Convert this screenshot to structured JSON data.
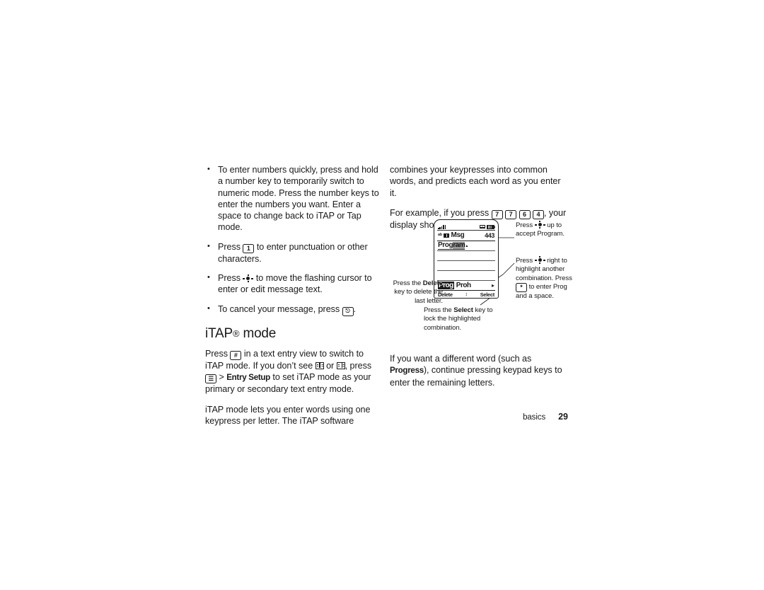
{
  "document": {
    "footer": {
      "section_label": "basics",
      "page_number": "29"
    }
  },
  "left_column": {
    "bullets": [
      {
        "id": "numbers-quickly",
        "text": "To enter numbers quickly, press and hold a number key to temporarily switch to numeric mode. Press the number keys to enter the numbers you want. Enter a space to change back to iTAP or Tap mode."
      },
      {
        "id": "punctuation",
        "text_before": "Press ",
        "key": "1",
        "text_after": " to enter punctuation or other characters."
      },
      {
        "id": "flashing-cursor",
        "text_before": "Press ",
        "key_icon": "navigation-key",
        "text_after": " to move the flashing cursor to enter or edit message text."
      },
      {
        "id": "cancel-message",
        "text_before": "To cancel your message, press ",
        "key": "power-key",
        "text_after": "."
      }
    ],
    "heading": {
      "title": "iTAP",
      "registered": "®",
      "suffix": " mode"
    },
    "paragraphs": [
      {
        "id": "switch-to-itap",
        "p1": "Press ",
        "key1": "#",
        "p2": " in a text entry view to switch to iTAP mode. If you don’t see ",
        "icon1": "book-icon",
        "p3": " or ",
        "icon2": "book-icon-2",
        "p4": ", press ",
        "key2": "menu-key",
        "p5": " > ",
        "bold1": "Entry Setup",
        "p6": " to set iTAP mode as your primary or secondary text entry mode."
      },
      {
        "id": "itap-description",
        "text": "iTAP mode lets you enter words using one keypress per letter. The iTAP software"
      }
    ]
  },
  "right_column": {
    "paragraphs": [
      {
        "id": "combines-keypresses",
        "text": "combines your keypresses into common words, and predicts each word as you enter it."
      },
      {
        "id": "for-example",
        "p1": "For example, if you press ",
        "keys": [
          "7",
          "7",
          "6",
          "4"
        ],
        "p2": ", your display shows:"
      }
    ],
    "closing_paragraph": {
      "id": "different-word",
      "p1": "If you want a different word (such as ",
      "bold1": "Progress",
      "p2": "), continue pressing keypad keys to enter the remaining letters."
    }
  },
  "figure": {
    "phone_screen": {
      "status_bar": {
        "signal_icon": "signal-strength-icon",
        "message_icon": "envelope-icon",
        "battery_icon": "battery-icon"
      },
      "header": {
        "mode_tag": "ab",
        "dictionary_icon": "book-icon",
        "title": "Msg",
        "counter": "443"
      },
      "entry_line": {
        "typed_prefix": "Prog",
        "predicted_suffix": "ram",
        "caret": "▴"
      },
      "candidates": {
        "selected": "Prog",
        "alternate": "Proh",
        "more_arrow": "▸"
      },
      "soft_keys": {
        "left": "Delete",
        "center": "↕",
        "right": "Select"
      }
    },
    "callouts": [
      {
        "id": "accept-program",
        "p1": "Press ",
        "key_icon": "navigation-key",
        "p2": " up to accept Program."
      },
      {
        "id": "highlight-another",
        "p1": "Press ",
        "key_icon": "navigation-key",
        "p2": " right to highlight another combination. Press ",
        "key2": "*",
        "p3": " to enter Prog and a space."
      },
      {
        "id": "delete-key",
        "p1": "Press the ",
        "bold1": "Delete",
        "p2": " key to delete the last letter."
      },
      {
        "id": "select-key",
        "p1": "Press the ",
        "bold1": "Select",
        "p2": " key to lock the highlighted combination."
      }
    ]
  }
}
